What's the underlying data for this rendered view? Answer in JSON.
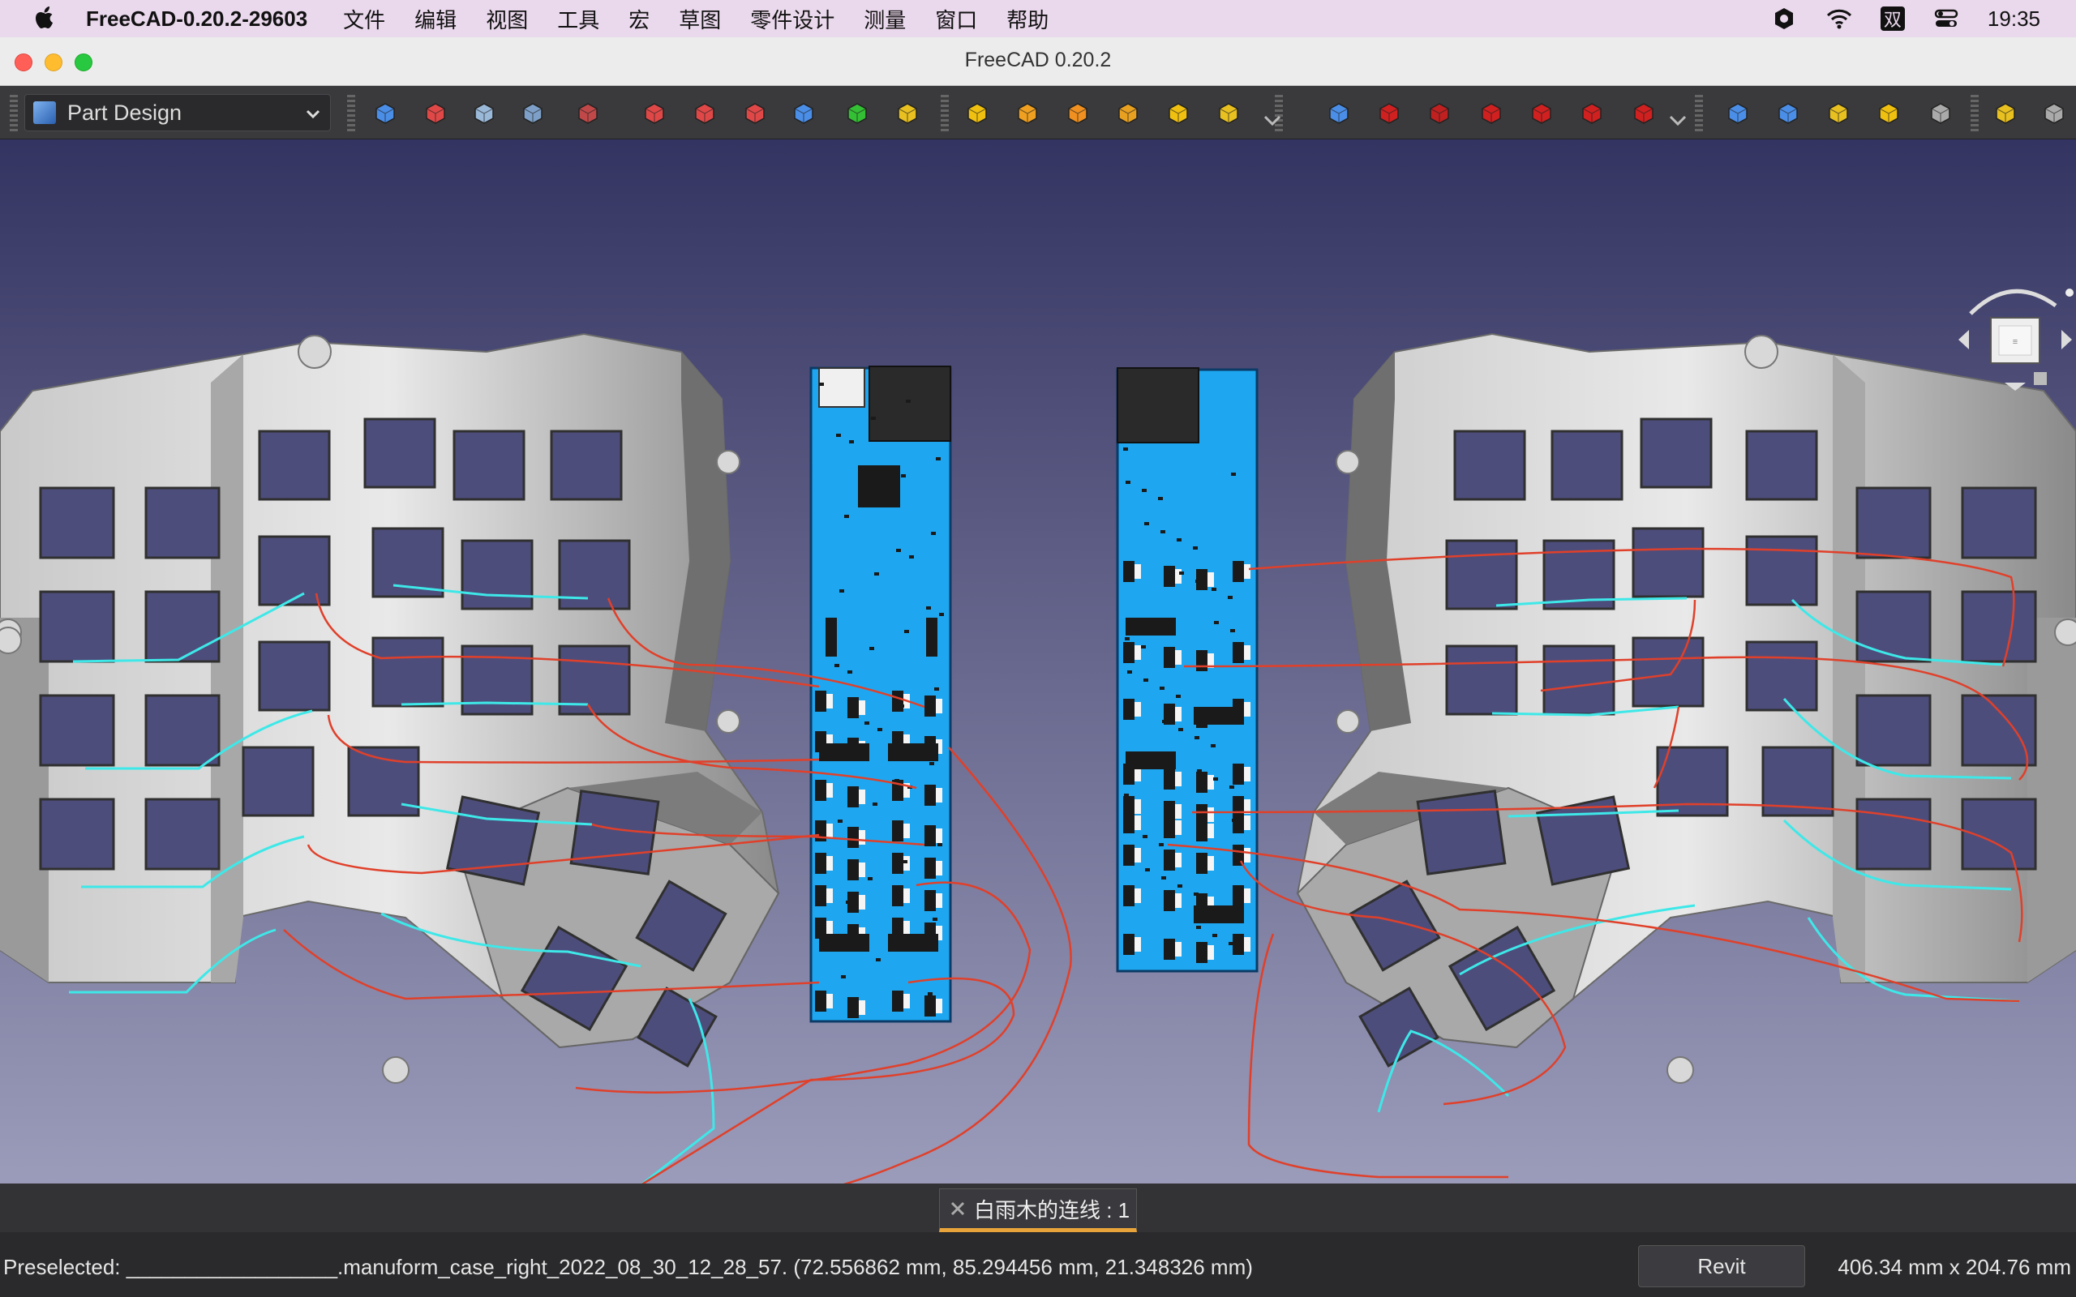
{
  "menubar": {
    "app_name": "FreeCAD-0.20.2-29603",
    "items": [
      "文件",
      "编辑",
      "视图",
      "工具",
      "宏",
      "草图",
      "零件设计",
      "测量",
      "窗口",
      "帮助"
    ],
    "input_method": "双",
    "time": "19:35"
  },
  "window": {
    "title": "FreeCAD 0.20.2"
  },
  "toolbar": {
    "workbench": "Part Design",
    "icons": [
      "body-icon",
      "sketch-icon",
      "attach-icon",
      "clone-icon",
      "datum-point-icon",
      "datum-line-icon",
      "datum-plane-icon",
      "local-cs-icon",
      "shape-binder-icon",
      "subshape-binder-icon",
      "pad-icon",
      "additive-loft-icon",
      "revolution-icon",
      "additive-box-icon",
      "additive-pipe-icon",
      "additive-helix-icon",
      "additive-primitive-icon",
      "pocket-icon",
      "hole-icon",
      "groove-icon",
      "subtractive-loft-icon",
      "subtractive-pipe-icon",
      "subtractive-helix-icon",
      "subtractive-primitive-icon",
      "mirror-icon",
      "linear-pattern-icon",
      "polar-pattern-icon",
      "multitransform-icon",
      "more-icon",
      "fillet-icon",
      "more-icon-2"
    ]
  },
  "document_tab": {
    "label": "白雨木的连线 : 1"
  },
  "status": {
    "preselected": "Preselected: __________________.manuform_case_right_2022_08_30_12_28_57. (72.556862 mm, 85.294456 mm, 21.348326 mm)",
    "navigation_style": "Revit",
    "dimensions": "406.34 mm x 204.76 mm"
  },
  "colors": {
    "menubar_bg": "#ead8ec",
    "toolbar_bg": "#3a3a3c",
    "viewport_top": "#353562",
    "viewport_bottom": "#9a9aba",
    "pcb_blue": "#1ea7f0",
    "wire_red": "#e0402a",
    "wire_cyan": "#3ee8e8",
    "tab_accent": "#e8a33a"
  }
}
